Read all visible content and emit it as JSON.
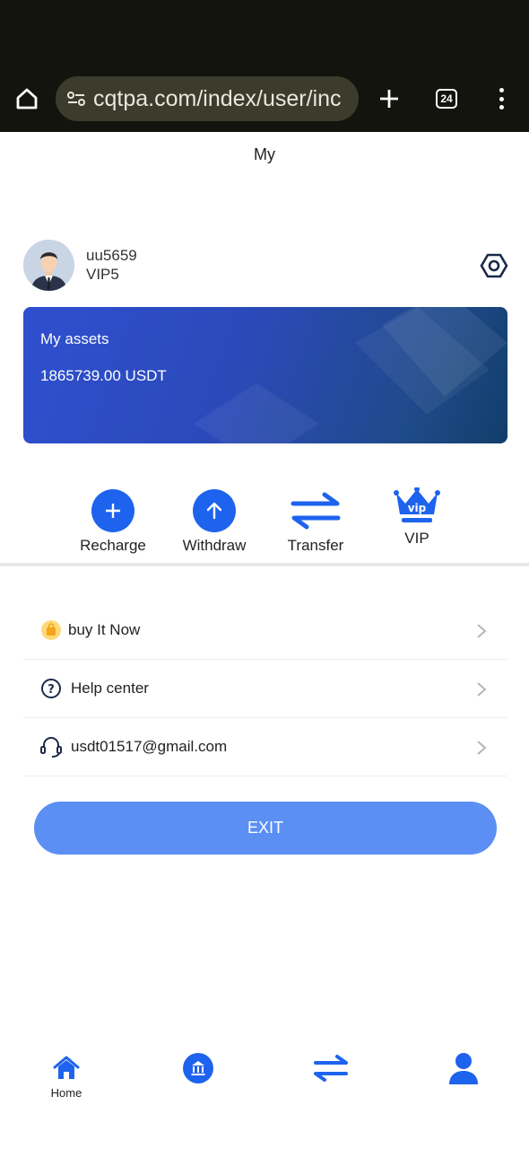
{
  "browser": {
    "url": "cqtpa.com/index/user/inc",
    "tab_count": "24",
    "icons": [
      "home-icon",
      "site-settings-icon",
      "new-tab-icon",
      "tab-switcher-icon",
      "more-menu-icon"
    ]
  },
  "header": {
    "title": "My"
  },
  "user": {
    "username": "uu5659",
    "vip_level": "VIP5"
  },
  "assets": {
    "label": "My assets",
    "value": "1865739.00 USDT"
  },
  "actions": [
    {
      "label": "Recharge",
      "icon": "plus-icon"
    },
    {
      "label": "Withdraw",
      "icon": "arrow-up-icon"
    },
    {
      "label": "Transfer",
      "icon": "swap-arrows-icon"
    },
    {
      "label": "VIP",
      "icon": "vip-crown-icon"
    }
  ],
  "menu": [
    {
      "label": "buy It Now",
      "icon": "shop-bag-icon"
    },
    {
      "label": "Help center",
      "icon": "question-icon"
    },
    {
      "label": "usdt01517@gmail.com",
      "icon": "headset-icon"
    }
  ],
  "exit_label": "EXIT",
  "bottom_nav": [
    {
      "label": "Home",
      "icon": "home-icon"
    },
    {
      "label": "",
      "icon": "bank-icon"
    },
    {
      "label": "",
      "icon": "swap-arrows-icon"
    },
    {
      "label": "",
      "icon": "user-icon"
    }
  ],
  "colors": {
    "accent": "#1e63ee",
    "exit_button": "#5b8ff3",
    "card_start": "#2f4fd0",
    "card_end": "#123d6a"
  }
}
